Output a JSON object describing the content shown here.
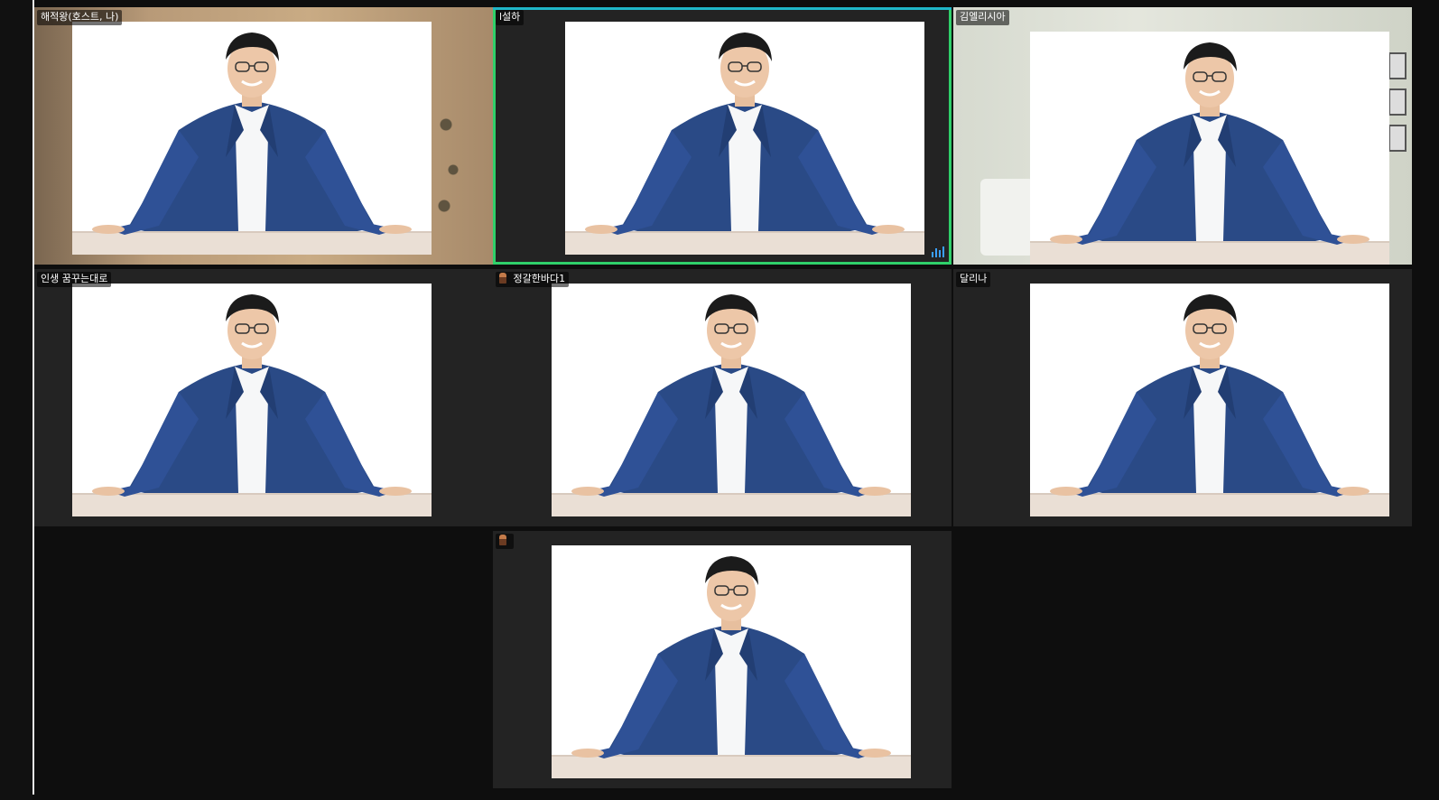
{
  "window": {
    "title": ""
  },
  "participants": [
    {
      "id": "p1",
      "name": "해적왕(호스트, 나)",
      "has_icon": false,
      "active": false,
      "background": "room"
    },
    {
      "id": "p2",
      "name": "l설하",
      "has_icon": false,
      "active": true,
      "background": "dark"
    },
    {
      "id": "p3",
      "name": "김엘리시아",
      "has_icon": false,
      "active": false,
      "background": "living"
    },
    {
      "id": "p4",
      "name": "인생 꿈꾸는대로",
      "has_icon": false,
      "active": false,
      "background": "dark"
    },
    {
      "id": "p5",
      "name": "정갈한바다1",
      "has_icon": true,
      "active": false,
      "background": "dark"
    },
    {
      "id": "p6",
      "name": "달리나",
      "has_icon": false,
      "active": false,
      "background": "dark"
    },
    {
      "id": "p7",
      "name": "",
      "has_icon": true,
      "active": false,
      "background": "dark"
    }
  ],
  "colors": {
    "active_border": "#2fd06a",
    "active_border_top": "#1fb6c8",
    "audio_indicator": "#3aa0ff",
    "tile_bg": "#232323",
    "app_bg": "#0e0e0e",
    "suit": "#2a4a86"
  },
  "icons": {
    "speaking": "audio-level-icon",
    "participant_avatar": "avatar-mini-icon"
  }
}
